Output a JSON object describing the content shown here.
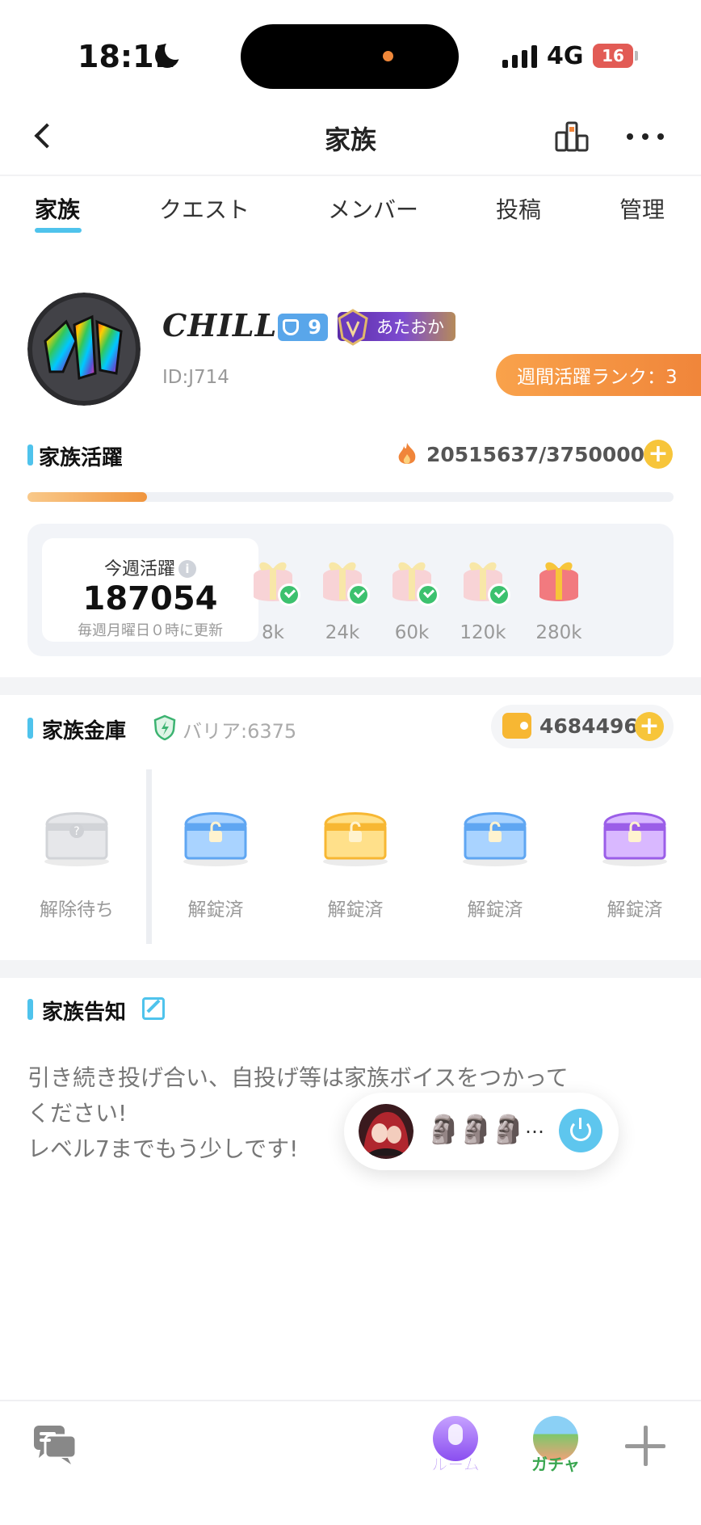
{
  "status_bar": {
    "time": "18:11",
    "network": "4G",
    "battery": "16"
  },
  "nav": {
    "title": "家族"
  },
  "tabs": [
    {
      "label": "家族",
      "active": true
    },
    {
      "label": "クエスト",
      "active": false
    },
    {
      "label": "メンバー",
      "active": false
    },
    {
      "label": "投稿",
      "active": false
    },
    {
      "label": "管理",
      "active": false
    }
  ],
  "profile": {
    "name": "CHILL.",
    "level": "9",
    "title_badge": "あたおか",
    "id": "ID:J714",
    "weekly_rank": "週間活躍ランク：3"
  },
  "activity": {
    "heading": "家族活躍",
    "current": 20515637,
    "target": 37500000,
    "count_text": "20515637/37500000",
    "progress_fraction": 0.185,
    "weekly_label": "今週活躍",
    "weekly_value": "187054",
    "weekly_note": "毎週月曜日０時に更新",
    "info_glyph": "i",
    "milestones": [
      {
        "label": "8k",
        "claimed": true
      },
      {
        "label": "24k",
        "claimed": true
      },
      {
        "label": "60k",
        "claimed": true
      },
      {
        "label": "120k",
        "claimed": true
      },
      {
        "label": "280k",
        "claimed": false
      }
    ]
  },
  "vault": {
    "heading": "家族金庫",
    "barrier": "バリア:6375",
    "coins": "4684496",
    "plus_glyph": "+",
    "chests": [
      {
        "label": "解除待ち",
        "style": "locked-gray"
      },
      {
        "label": "解錠済",
        "style": "blue"
      },
      {
        "label": "解錠済",
        "style": "gold"
      },
      {
        "label": "解錠済",
        "style": "blue"
      },
      {
        "label": "解錠済",
        "style": "purple"
      }
    ]
  },
  "notice": {
    "heading": "家族告知",
    "lines": [
      "引き続き投げ合い、自投げ等は家族ボイスをつかって",
      "ください!",
      "レベル7までもう少しです!"
    ]
  },
  "room_widget": {
    "member_emoji": [
      "🗿",
      "🗿",
      "🗿"
    ],
    "more": "…"
  },
  "bottom_bar": {
    "room_label": "ルーム",
    "gacha_label": "ガチャ"
  },
  "colors": {
    "accent": "#4fc3ec",
    "orange": "#f0853a",
    "coin": "#f7c53a",
    "check": "#3cc16e"
  }
}
